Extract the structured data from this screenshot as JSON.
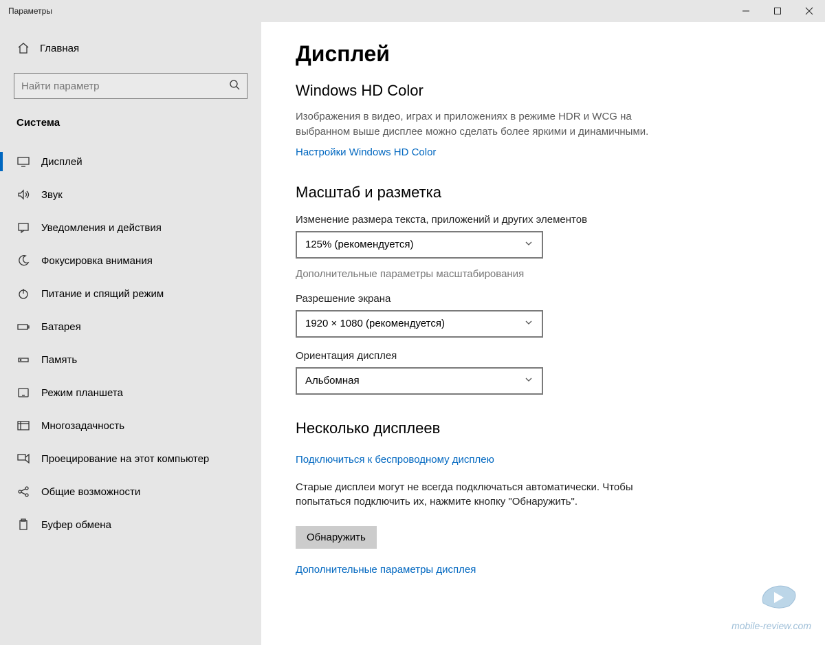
{
  "window": {
    "title": "Параметры"
  },
  "sidebar": {
    "home": "Главная",
    "search_placeholder": "Найти параметр",
    "section": "Система",
    "items": [
      {
        "label": "Дисплей",
        "icon": "monitor-icon",
        "selected": true
      },
      {
        "label": "Звук",
        "icon": "sound-icon"
      },
      {
        "label": "Уведомления и действия",
        "icon": "notifications-icon"
      },
      {
        "label": "Фокусировка внимания",
        "icon": "moon-icon"
      },
      {
        "label": "Питание и спящий режим",
        "icon": "power-icon"
      },
      {
        "label": "Батарея",
        "icon": "battery-icon"
      },
      {
        "label": "Память",
        "icon": "storage-icon"
      },
      {
        "label": "Режим планшета",
        "icon": "tablet-icon"
      },
      {
        "label": "Многозадачность",
        "icon": "multitask-icon"
      },
      {
        "label": "Проецирование на этот компьютер",
        "icon": "project-icon"
      },
      {
        "label": "Общие возможности",
        "icon": "shared-icon"
      },
      {
        "label": "Буфер обмена",
        "icon": "clipboard-icon"
      }
    ]
  },
  "main": {
    "title": "Дисплей",
    "hdcolor": {
      "heading": "Windows HD Color",
      "desc": "Изображения в видео, играх и приложениях в режиме HDR и WCG на выбранном выше дисплее можно сделать более яркими и динамичными.",
      "link": "Настройки Windows HD Color"
    },
    "scale": {
      "heading": "Масштаб и разметка",
      "size_label": "Изменение размера текста, приложений и других элементов",
      "size_value": "125% (рекомендуется)",
      "advanced_link": "Дополнительные параметры масштабирования",
      "resolution_label": "Разрешение экрана",
      "resolution_value": "1920 × 1080 (рекомендуется)",
      "orientation_label": "Ориентация дисплея",
      "orientation_value": "Альбомная"
    },
    "multi": {
      "heading": "Несколько дисплеев",
      "wireless_link": "Подключиться к беспроводному дисплею",
      "desc": "Старые дисплеи могут не всегда подключаться автоматически. Чтобы попытаться подключить их, нажмите кнопку \"Обнаружить\".",
      "detect_btn": "Обнаружить",
      "advanced_link": "Дополнительные параметры дисплея"
    }
  },
  "watermark": "mobile-review.com"
}
